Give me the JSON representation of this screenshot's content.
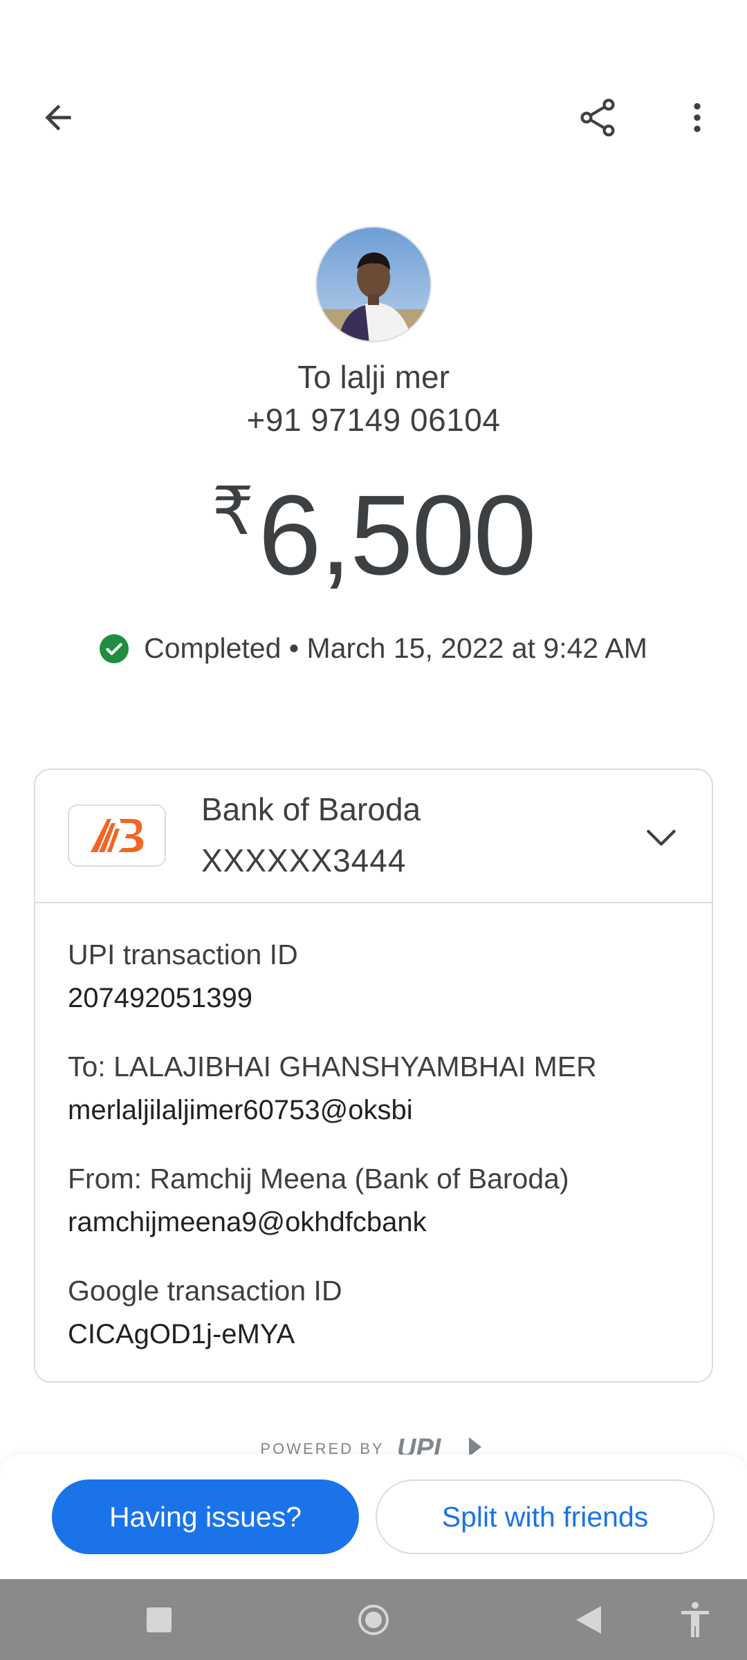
{
  "top_bar": {
    "back_icon": "arrow-left-icon",
    "share_icon": "share-icon",
    "more_icon": "more-vert-icon"
  },
  "recipient": {
    "avatar_icon": "profile-photo",
    "to_label": "To lalji mer",
    "phone": "+91 97149 06104"
  },
  "amount": {
    "currency": "₹",
    "value": "6,500"
  },
  "status": {
    "icon": "check-circle-icon",
    "text": "Completed • March 15, 2022 at 9:42 AM",
    "color": "#1e8e3e"
  },
  "account": {
    "bank_name": "Bank of Baroda",
    "account_number": "XXXXXX3444",
    "logo_icon": "bank-of-baroda-logo",
    "expand_icon": "chevron-down-icon",
    "logo_color": "#f26522"
  },
  "details": [
    {
      "label": "UPI transaction ID",
      "value": "207492051399"
    },
    {
      "label": "To: LALAJIBHAI GHANSHYAMBHAI MER",
      "value": "merlaljilaljimer60753@oksbi"
    },
    {
      "label": "From: Ramchij Meena (Bank of Baroda)",
      "value": "ramchijmeena9@okhdfcbank"
    },
    {
      "label": "Google transaction ID",
      "value": "CICAgOD1j-eMYA"
    }
  ],
  "footer": {
    "powered_by": "POWERED BY",
    "upi_logo": "UPI"
  },
  "actions": {
    "primary_label": "Having issues?",
    "secondary_label": "Split with friends",
    "accent": "#1a73e8"
  },
  "system_nav": {
    "recents_icon": "square-icon",
    "home_icon": "circle-icon",
    "back_icon": "triangle-back-icon",
    "accessibility_icon": "accessibility-icon"
  }
}
